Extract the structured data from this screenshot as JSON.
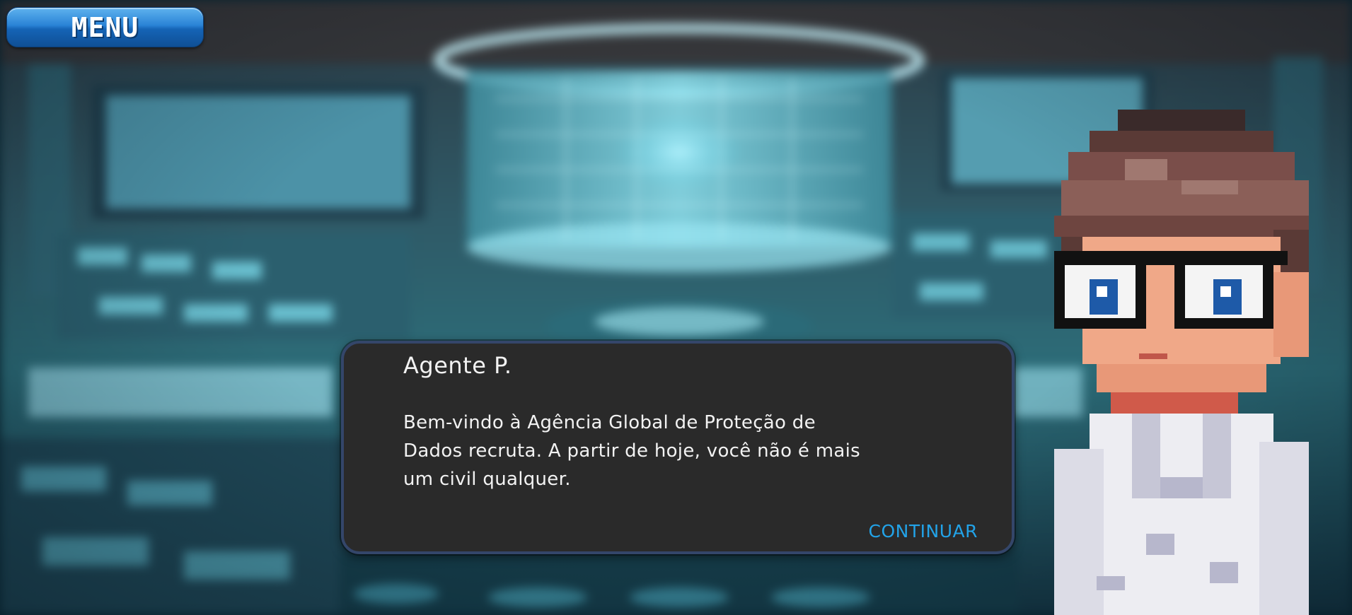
{
  "menu": {
    "label": "MENU"
  },
  "dialog": {
    "speaker": "Agente P.",
    "text": "Bem-vindo à Agência Global de Proteção de Dados recruta. A partir de hoje, você não é mais um civil qualquer.",
    "continue_label": "CONTINUAR"
  },
  "colors": {
    "menu_button": "#2a83d6",
    "dialog_background": "#2a2a2a",
    "dialog_border": "#34466a",
    "continue_text": "#22a3e8",
    "dialog_text": "#f2f2f2"
  },
  "scene": {
    "background_icon": "futuristic-control-room",
    "character_icon": "pixel-art-agent-with-glasses"
  }
}
